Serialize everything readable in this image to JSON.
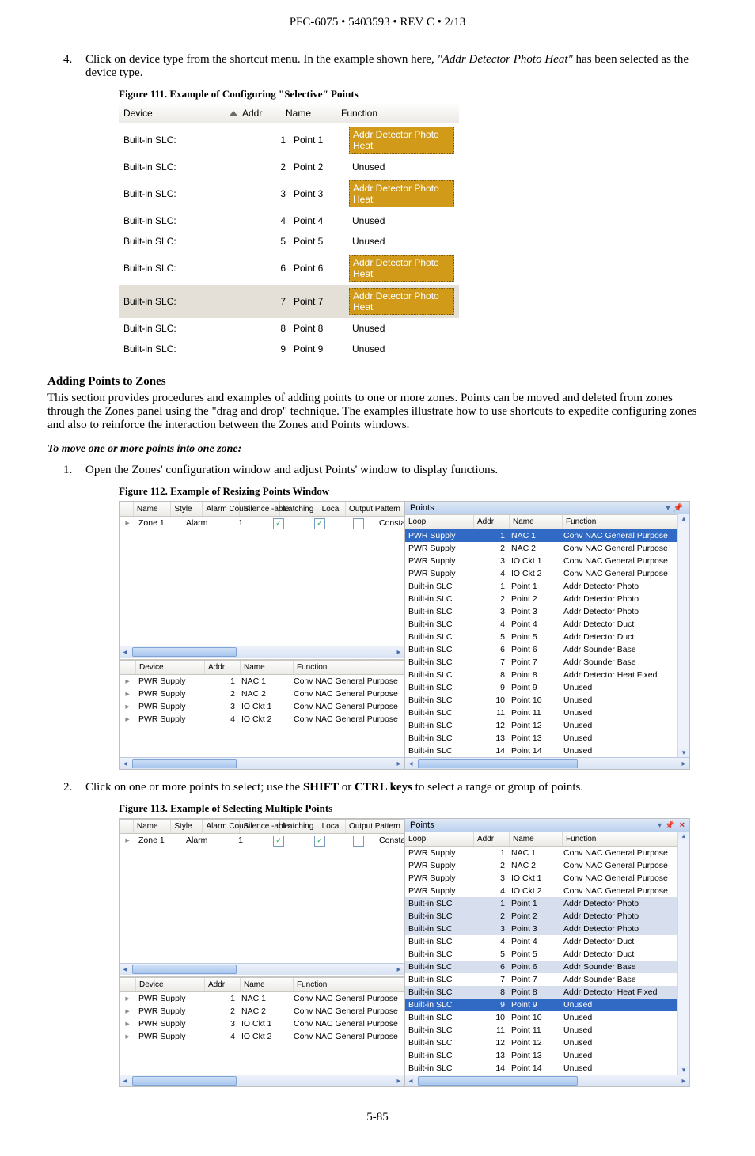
{
  "header": "PFC-6075 • 5403593 • REV C • 2/13",
  "step4_num": "4.",
  "step4_a": "Click on device type from the shortcut menu. In the example shown here, ",
  "step4_b": "\"Addr Detector Photo Heat\"",
  "step4_c": " has been selected as the device type.",
  "fig111_caption": "Figure 111. Example of Configuring \"Selective\" Points",
  "fig111": {
    "head": {
      "device": "Device",
      "addr": "Addr",
      "name": "Name",
      "func": "Function"
    },
    "rows": [
      {
        "device": "Built-in SLC:",
        "addr": "1",
        "name": "Point 1",
        "func": "Addr Detector Photo Heat",
        "hl": true,
        "sel": false
      },
      {
        "device": "Built-in SLC:",
        "addr": "2",
        "name": "Point 2",
        "func": "Unused",
        "hl": false,
        "sel": false
      },
      {
        "device": "Built-in SLC:",
        "addr": "3",
        "name": "Point 3",
        "func": "Addr Detector Photo Heat",
        "hl": true,
        "sel": false
      },
      {
        "device": "Built-in SLC:",
        "addr": "4",
        "name": "Point 4",
        "func": "Unused",
        "hl": false,
        "sel": false
      },
      {
        "device": "Built-in SLC:",
        "addr": "5",
        "name": "Point 5",
        "func": "Unused",
        "hl": false,
        "sel": false
      },
      {
        "device": "Built-in SLC:",
        "addr": "6",
        "name": "Point 6",
        "func": "Addr Detector Photo Heat",
        "hl": true,
        "sel": false
      },
      {
        "device": "Built-in SLC:",
        "addr": "7",
        "name": "Point 7",
        "func": "Addr Detector Photo Heat",
        "hl": true,
        "sel": true
      },
      {
        "device": "Built-in SLC:",
        "addr": "8",
        "name": "Point 8",
        "func": "Unused",
        "hl": false,
        "sel": false
      },
      {
        "device": "Built-in SLC:",
        "addr": "9",
        "name": "Point 9",
        "func": "Unused",
        "hl": false,
        "sel": false
      }
    ]
  },
  "sectionHeading": "Adding Points to Zones",
  "sectionPara": "This section provides procedures and examples of adding points to one or more zones. Points can be moved and deleted from zones through the Zones panel using the \"drag and drop\" technique. The examples illustrate how to use shortcuts to expedite configuring zones and also to reinforce the interaction between the Zones and Points windows.",
  "subHeading_a": "To move one or more points into ",
  "subHeading_u": "one",
  "subHeading_b": " zone:",
  "step1_num": "1.",
  "step1_text": "Open the Zones' configuration window and adjust Points' window to display functions.",
  "fig112_caption": "Figure 112. Example of Resizing Points Window",
  "step2_num": "2.",
  "step2_a": "Click on one or more points to select; use the ",
  "step2_shift": "SHIFT",
  "step2_or": " or ",
  "step2_ctrl": "CTRL keys",
  "step2_b": " to select a range or group of points.",
  "fig113_caption": "Figure 113. Example of Selecting Multiple Points",
  "zones_head": {
    "name": "Name",
    "style": "Style",
    "alarm": "Alarm Count",
    "sil": "Silence -able",
    "lat": "Latching",
    "loc": "Local",
    "op": "Output Pattern"
  },
  "zones_row": {
    "name": "Zone 1",
    "style": "Alarm",
    "alarm": "1",
    "op": "Constant"
  },
  "mini_head": {
    "device": "Device",
    "addr": "Addr",
    "name": "Name",
    "func": "Function"
  },
  "mini_rows": [
    {
      "device": "PWR Supply",
      "addr": "1",
      "name": "NAC 1",
      "func": "Conv NAC General Purpose"
    },
    {
      "device": "PWR Supply",
      "addr": "2",
      "name": "NAC 2",
      "func": "Conv NAC General Purpose"
    },
    {
      "device": "PWR Supply",
      "addr": "3",
      "name": "IO Ckt 1",
      "func": "Conv NAC General Purpose"
    },
    {
      "device": "PWR Supply",
      "addr": "4",
      "name": "IO Ckt 2",
      "func": "Conv NAC General Purpose"
    }
  ],
  "points_title": "Points",
  "points_head": {
    "loop": "Loop",
    "addr": "Addr",
    "name": "Name",
    "func": "Function"
  },
  "points112": [
    {
      "loop": "PWR Supply",
      "addr": "1",
      "name": "NAC 1",
      "func": "Conv NAC General Purpose",
      "sel": "sel"
    },
    {
      "loop": "PWR Supply",
      "addr": "2",
      "name": "NAC 2",
      "func": "Conv NAC General Purpose"
    },
    {
      "loop": "PWR Supply",
      "addr": "3",
      "name": "IO Ckt 1",
      "func": "Conv NAC General Purpose"
    },
    {
      "loop": "PWR Supply",
      "addr": "4",
      "name": "IO Ckt 2",
      "func": "Conv NAC General Purpose"
    },
    {
      "loop": "Built-in SLC",
      "addr": "1",
      "name": "Point 1",
      "func": "Addr Detector Photo"
    },
    {
      "loop": "Built-in SLC",
      "addr": "2",
      "name": "Point 2",
      "func": "Addr Detector Photo"
    },
    {
      "loop": "Built-in SLC",
      "addr": "3",
      "name": "Point 3",
      "func": "Addr Detector Photo"
    },
    {
      "loop": "Built-in SLC",
      "addr": "4",
      "name": "Point 4",
      "func": "Addr Detector Duct"
    },
    {
      "loop": "Built-in SLC",
      "addr": "5",
      "name": "Point 5",
      "func": "Addr Detector Duct"
    },
    {
      "loop": "Built-in SLC",
      "addr": "6",
      "name": "Point 6",
      "func": "Addr Sounder Base"
    },
    {
      "loop": "Built-in SLC",
      "addr": "7",
      "name": "Point 7",
      "func": "Addr Sounder Base"
    },
    {
      "loop": "Built-in SLC",
      "addr": "8",
      "name": "Point 8",
      "func": "Addr Detector Heat Fixed"
    },
    {
      "loop": "Built-in SLC",
      "addr": "9",
      "name": "Point 9",
      "func": "Unused"
    },
    {
      "loop": "Built-in SLC",
      "addr": "10",
      "name": "Point 10",
      "func": "Unused"
    },
    {
      "loop": "Built-in SLC",
      "addr": "11",
      "name": "Point 11",
      "func": "Unused"
    },
    {
      "loop": "Built-in SLC",
      "addr": "12",
      "name": "Point 12",
      "func": "Unused"
    },
    {
      "loop": "Built-in SLC",
      "addr": "13",
      "name": "Point 13",
      "func": "Unused"
    },
    {
      "loop": "Built-in SLC",
      "addr": "14",
      "name": "Point 14",
      "func": "Unused"
    }
  ],
  "points113": [
    {
      "loop": "PWR Supply",
      "addr": "1",
      "name": "NAC 1",
      "func": "Conv NAC General Purpose"
    },
    {
      "loop": "PWR Supply",
      "addr": "2",
      "name": "NAC 2",
      "func": "Conv NAC General Purpose"
    },
    {
      "loop": "PWR Supply",
      "addr": "3",
      "name": "IO Ckt 1",
      "func": "Conv NAC General Purpose"
    },
    {
      "loop": "PWR Supply",
      "addr": "4",
      "name": "IO Ckt 2",
      "func": "Conv NAC General Purpose"
    },
    {
      "loop": "Built-in SLC",
      "addr": "1",
      "name": "Point 1",
      "func": "Addr Detector Photo",
      "sel": "sel-lite"
    },
    {
      "loop": "Built-in SLC",
      "addr": "2",
      "name": "Point 2",
      "func": "Addr Detector Photo",
      "sel": "sel-lite"
    },
    {
      "loop": "Built-in SLC",
      "addr": "3",
      "name": "Point 3",
      "func": "Addr Detector Photo",
      "sel": "sel-lite"
    },
    {
      "loop": "Built-in SLC",
      "addr": "4",
      "name": "Point 4",
      "func": "Addr Detector Duct"
    },
    {
      "loop": "Built-in SLC",
      "addr": "5",
      "name": "Point 5",
      "func": "Addr Detector Duct"
    },
    {
      "loop": "Built-in SLC",
      "addr": "6",
      "name": "Point 6",
      "func": "Addr Sounder Base",
      "sel": "sel-lite"
    },
    {
      "loop": "Built-in SLC",
      "addr": "7",
      "name": "Point 7",
      "func": "Addr Sounder Base"
    },
    {
      "loop": "Built-in SLC",
      "addr": "8",
      "name": "Point 8",
      "func": "Addr Detector Heat Fixed",
      "sel": "sel-lite"
    },
    {
      "loop": "Built-in SLC",
      "addr": "9",
      "name": "Point 9",
      "func": "Unused",
      "sel": "sel"
    },
    {
      "loop": "Built-in SLC",
      "addr": "10",
      "name": "Point 10",
      "func": "Unused"
    },
    {
      "loop": "Built-in SLC",
      "addr": "11",
      "name": "Point 11",
      "func": "Unused"
    },
    {
      "loop": "Built-in SLC",
      "addr": "12",
      "name": "Point 12",
      "func": "Unused"
    },
    {
      "loop": "Built-in SLC",
      "addr": "13",
      "name": "Point 13",
      "func": "Unused"
    },
    {
      "loop": "Built-in SLC",
      "addr": "14",
      "name": "Point 14",
      "func": "Unused"
    }
  ],
  "pageNum": "5-85"
}
